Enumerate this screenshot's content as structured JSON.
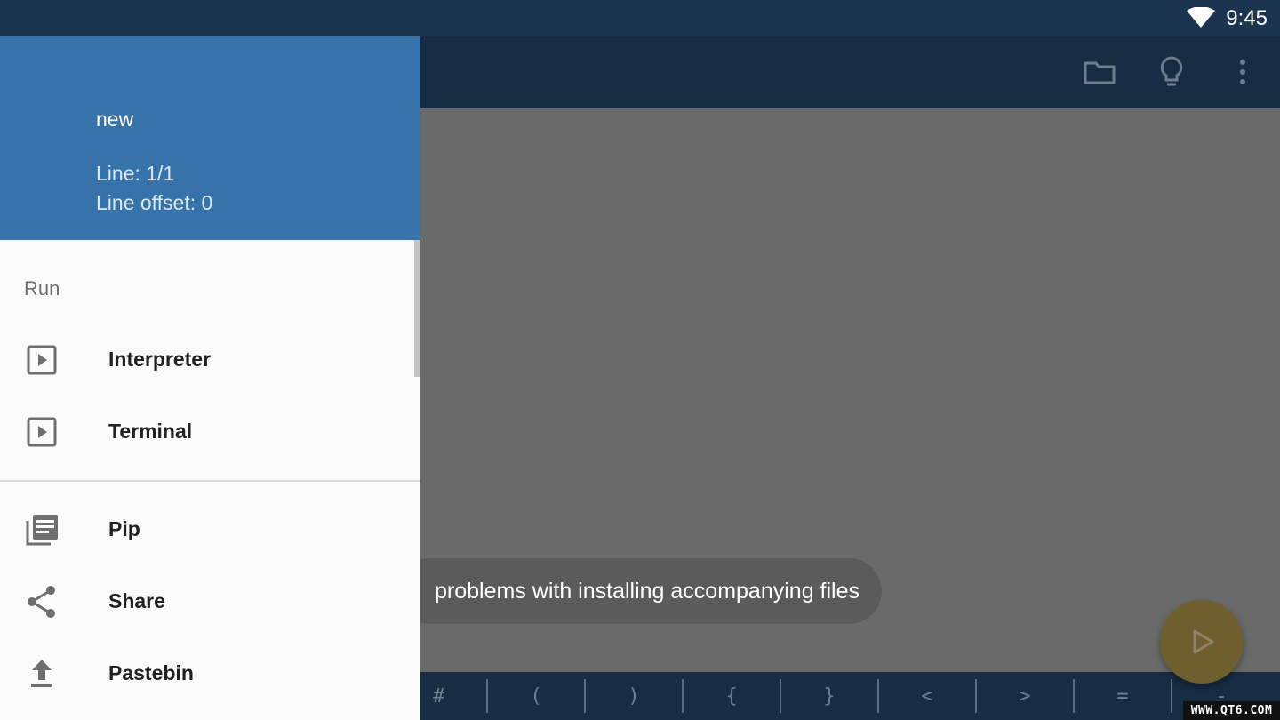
{
  "status_bar": {
    "time": "9:45",
    "wifi_icon": "wifi-icon"
  },
  "toolbar": {
    "actions": [
      {
        "icon": "folder-icon"
      },
      {
        "icon": "lightbulb-icon"
      },
      {
        "icon": "more-vert-icon"
      }
    ]
  },
  "drawer": {
    "header": {
      "file_name": "new",
      "line": "Line: 1/1",
      "line_offset": "Line offset: 0"
    },
    "section_run": "Run",
    "items": [
      {
        "label": "Interpreter",
        "icon": "play-box-icon"
      },
      {
        "label": "Terminal",
        "icon": "play-box-icon"
      },
      {
        "label": "Pip",
        "icon": "library-books-icon"
      },
      {
        "label": "Share",
        "icon": "share-icon"
      },
      {
        "label": "Pastebin",
        "icon": "upload-icon"
      }
    ]
  },
  "toast": {
    "message": "problems with installing accompanying files"
  },
  "symbol_bar": {
    "symbols": [
      "#",
      "(",
      ")",
      "{",
      "}",
      "<",
      ">",
      "=",
      "-"
    ]
  },
  "fab": {
    "icon": "play-icon"
  },
  "watermark": "WWW.QT6.COM",
  "colors": {
    "status_bar": "#1b3550",
    "toolbar": "#182d44",
    "drawer_header": "#3673aa",
    "drawer_bg": "#fafafa",
    "scrim": "#6a6a6a",
    "fab": "#6f5e2e"
  }
}
